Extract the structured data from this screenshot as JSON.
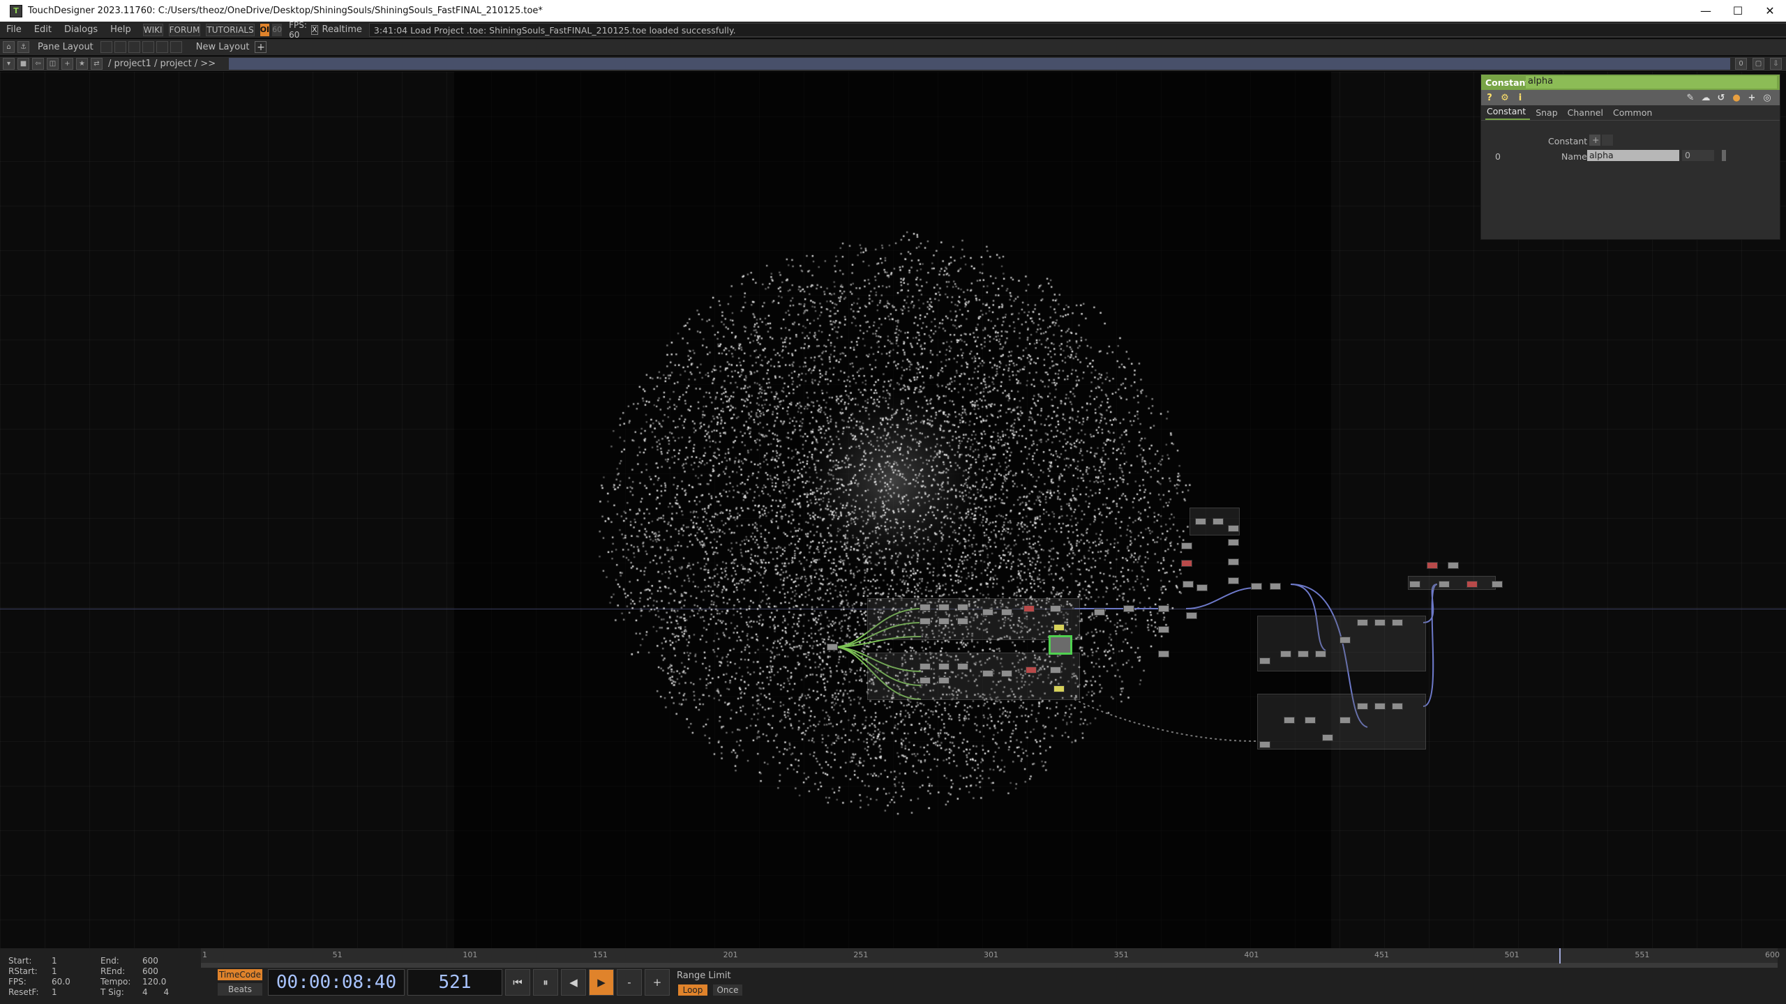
{
  "window": {
    "title": "TouchDesigner 2023.11760: C:/Users/theoz/OneDrive/Desktop/ShiningSouls/ShiningSouls_FastFINAL_210125.toe*",
    "minimize": "—",
    "maximize": "☐",
    "close": "✕"
  },
  "menubar": {
    "items": [
      "File",
      "Edit",
      "Dialogs",
      "Help"
    ],
    "wiki": "WIKI",
    "forum": "FORUM",
    "tutorials": "TUTORIALS",
    "oi": "OI",
    "fps_box": "60",
    "fps_label": "FPS:  60",
    "realtime_check": "X",
    "realtime": "Realtime",
    "status": "3:41:04 Load Project .toe: ShiningSouls_FastFINAL_210125.toe loaded successfully."
  },
  "panebar": {
    "pane_layout": "Pane Layout",
    "new_layout": "New Layout",
    "add": "+"
  },
  "pathbar": {
    "path": "/ project1 / project / >>",
    "right_value": "0"
  },
  "params": {
    "op_type": "Constant",
    "op_name": "alpha",
    "tabs": [
      "Constant",
      "Snap",
      "Channel",
      "Common"
    ],
    "section_label": "Constant",
    "row_index": "0",
    "name_label": "Name",
    "name_value": "alpha",
    "value": "0"
  },
  "timeline": {
    "stats": {
      "start_label": "Start:",
      "start": "1",
      "end_label": "End:",
      "end": "600",
      "rstart_label": "RStart:",
      "rstart": "1",
      "rend_label": "REnd:",
      "rend": "600",
      "fps_label": "FPS:",
      "fps": "60.0",
      "tempo_label": "Tempo:",
      "tempo": "120.0",
      "resetf_label": "ResetF:",
      "resetf": "1",
      "tsig_label": "T Sig:",
      "tsig": "4      4"
    },
    "ticks": [
      "1",
      "51",
      "101",
      "151",
      "201",
      "251",
      "301",
      "351",
      "401",
      "451",
      "501",
      "551",
      "600"
    ],
    "playhead_frame": 521,
    "timecode_btn": "TimeCode",
    "beats_btn": "Beats",
    "timecode": "00:00:08:40",
    "frame": "521",
    "buttons": [
      "⏮",
      "⏸",
      "◀",
      "▶",
      "-",
      "+"
    ],
    "range_limit": "Range Limit",
    "loop": "Loop",
    "once": "Once"
  },
  "colors": {
    "accent_orange": "#e0832b",
    "param_header_green": "#78a446",
    "path_bar_blue": "#48506a"
  }
}
